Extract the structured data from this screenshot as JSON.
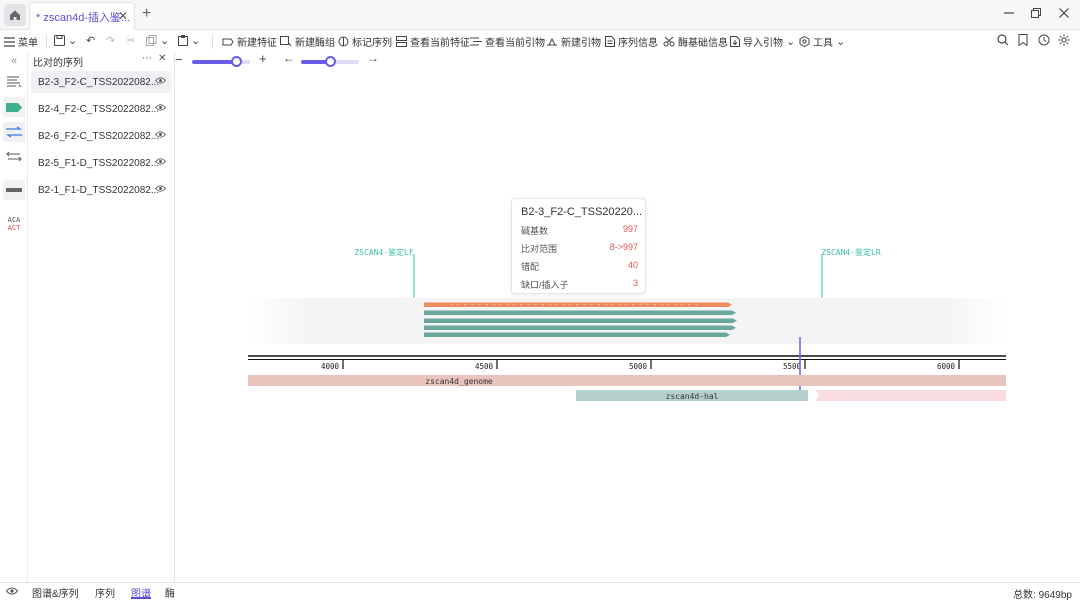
{
  "tabs": {
    "active_title": "* zscan4d-插入鉴...",
    "close": "✕",
    "new_tab": "+"
  },
  "toolbar": {
    "menu_label": "菜单",
    "new_feature": "新建特征",
    "new_enzyme_group": "新建酶组",
    "mark_sequence": "标记序列",
    "view_feature": "查看当前特征",
    "view_primer": "查看当前引物",
    "new_primer": "新建引物",
    "sequence_info": "序列信息",
    "enzyme_info": "酶基础信息",
    "import_primer": "导入引物",
    "tools": "工具"
  },
  "sequence_panel": {
    "title": "比对的序列",
    "items": [
      {
        "label": "B2-3_F2-C_TSS2022082...",
        "selected": true
      },
      {
        "label": "B2-4_F2-C_TSS2022082...",
        "selected": false
      },
      {
        "label": "B2-6_F2-C_TSS2022082...",
        "selected": false
      },
      {
        "label": "B2-5_F1-D_TSS2022082...",
        "selected": false
      },
      {
        "label": "B2-1_F1-D_TSS2022082...",
        "selected": false
      }
    ]
  },
  "rail": {
    "aca": "ACA",
    "act": "ACT"
  },
  "zoom": {
    "minus": "−",
    "plus": "+",
    "left_arrow": "←",
    "right_arrow": "→",
    "zoom_level": 0.75,
    "pan_level": 0.5
  },
  "tooltip": {
    "title": "B2-3_F2-C_TSS20220...",
    "rows": [
      {
        "key": "碱基数",
        "value": "997"
      },
      {
        "key": "比对范围",
        "value": "8->997"
      },
      {
        "key": "错配",
        "value": "40"
      },
      {
        "key": "缺口/插入子",
        "value": "3"
      }
    ]
  },
  "map": {
    "primer_left": "ZSCAN4-鉴定LF",
    "primer_right": "ZSCAN4-鉴定LR",
    "ruler_ticks": [
      "4000",
      "4500",
      "5000",
      "5500",
      "6000"
    ],
    "genome_label": "zscan4d_genome",
    "hal_label": "zscan4d-hal"
  },
  "colors": {
    "accent": "#6a5ce6",
    "orange_read": "#ef8a5a",
    "teal_read": "#6aa89e",
    "primer": "#3cbfa8",
    "genome": "#e8c4bc",
    "hal": "#b4d0cc",
    "pink": "#f8dce0",
    "red_value": "#e05555"
  },
  "status": {
    "tabs": [
      "图谱&序列",
      "序列",
      "图谱",
      "酶"
    ],
    "active_tab": "图谱",
    "total_label": "总数: 9649bp"
  }
}
